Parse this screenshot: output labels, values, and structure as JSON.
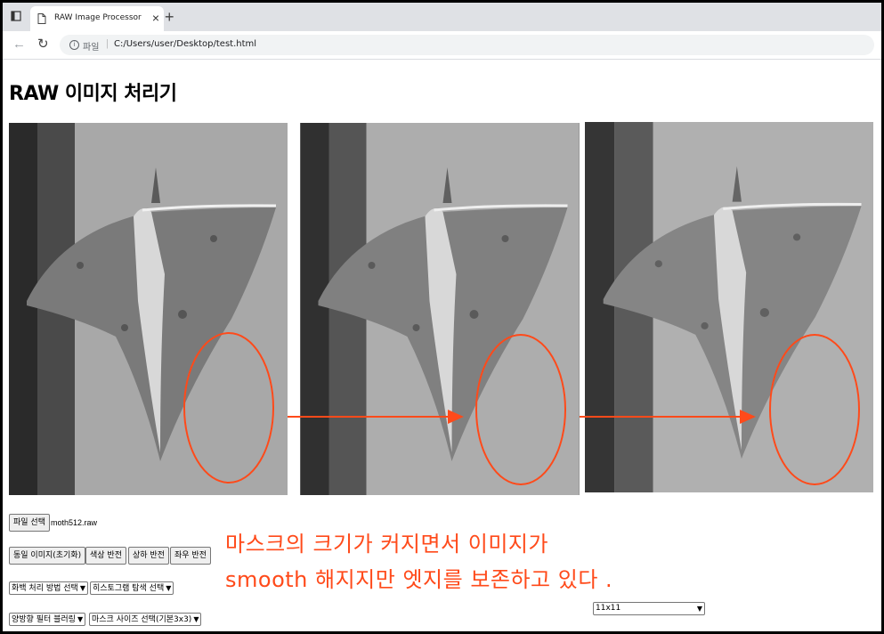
{
  "browser": {
    "tab_title": "RAW Image Processor",
    "new_tab_symbol": "+",
    "close_symbol": "×",
    "address_scheme": "파일",
    "address_url": "C:/Users/user/Desktop/test.html",
    "icons": [
      "window-icon",
      "page-icon",
      "back-icon",
      "reload-icon",
      "info-icon"
    ]
  },
  "page": {
    "title": "RAW 이미지 처리기",
    "file_button": "파일 선택",
    "file_name": "moth512.raw",
    "buttons": [
      "동일 이미지(초기화)",
      "색상 반전",
      "상하 반전",
      "좌우 반전"
    ],
    "selects": {
      "point_processing": "화백 처리 방법 선택",
      "histogram": "히스토그램 탐색 선택",
      "blurring": "양방향 필터 블러링",
      "mask_size": "마스크 사이즈 선택(기본3x3)",
      "mask_value": "11x11"
    }
  },
  "annotation": {
    "note_line1": "마스크의 크기가 커지면서 이미지가",
    "note_line2": "smooth  해지지만 엣지를 보존하고 있다 .",
    "color": "#ff4a1a"
  },
  "images": [
    {
      "name": "original",
      "description_icon": "moth-image"
    },
    {
      "name": "filtered-1",
      "description_icon": "moth-image"
    },
    {
      "name": "filtered-2",
      "description_icon": "moth-image"
    }
  ]
}
